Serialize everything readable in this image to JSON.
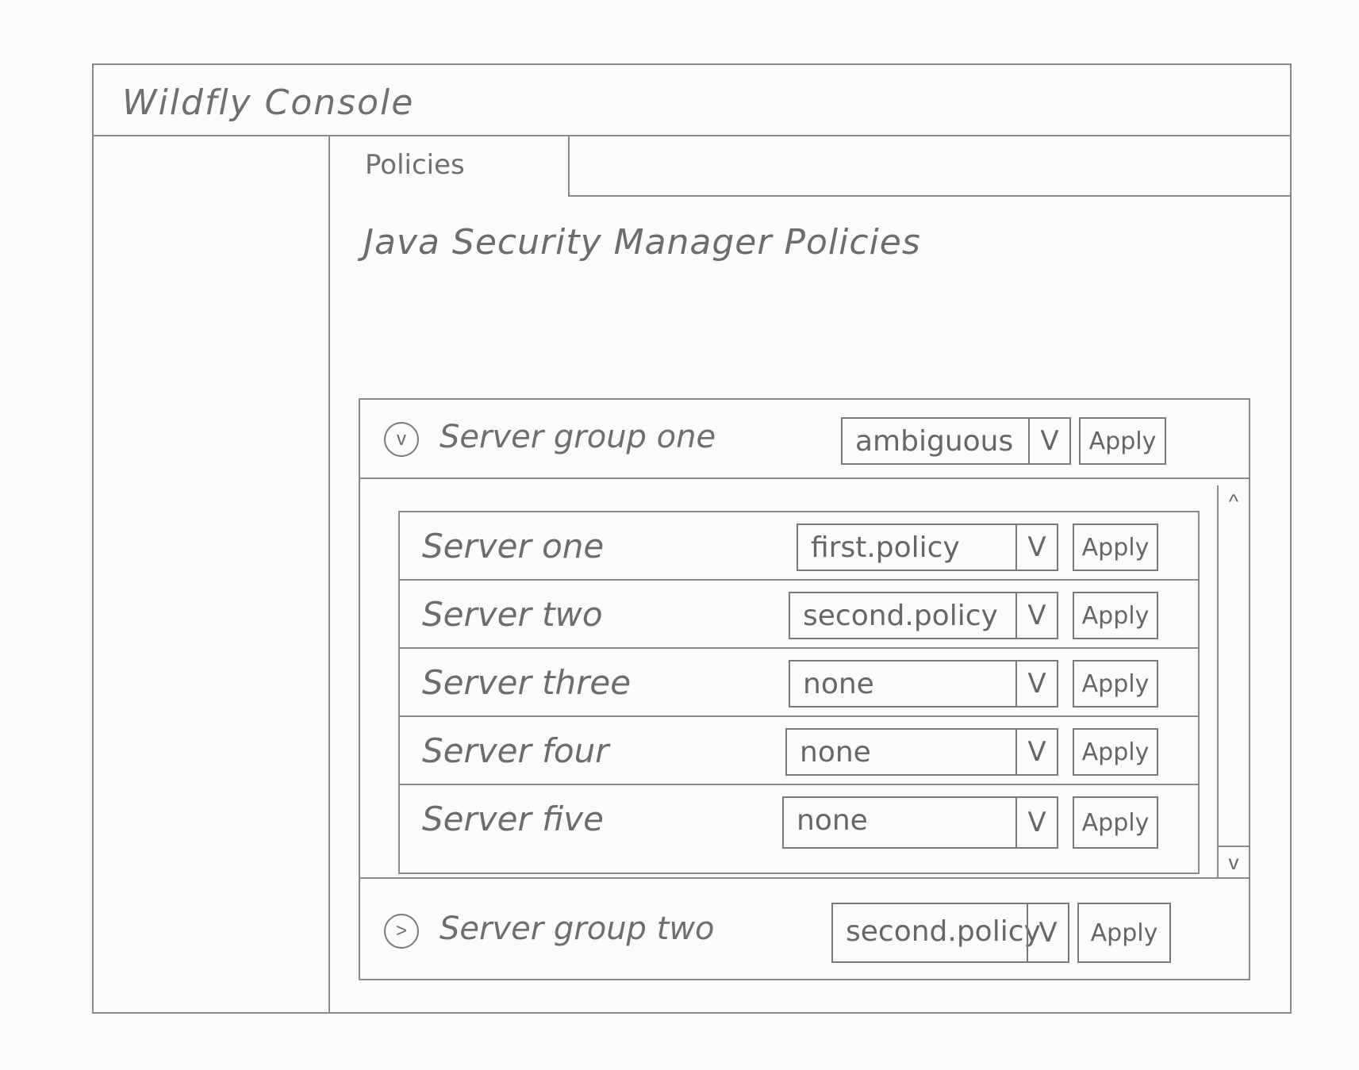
{
  "app": {
    "title": "Wildfly Console"
  },
  "tabs": [
    {
      "label": "Policies"
    }
  ],
  "page": {
    "title": "Java Security Manager Policies"
  },
  "groups": [
    {
      "name": "Server group one",
      "expanded": true,
      "toggle_icon": "v",
      "policy": "ambiguous",
      "apply_label": "Apply",
      "servers": [
        {
          "name": "Server one",
          "policy": "first.policy",
          "apply_label": "Apply"
        },
        {
          "name": "Server two",
          "policy": "second.policy",
          "apply_label": "Apply"
        },
        {
          "name": "Server three",
          "policy": "none",
          "apply_label": "Apply"
        },
        {
          "name": "Server four",
          "policy": "none",
          "apply_label": "Apply"
        },
        {
          "name": "Server five",
          "policy": "none",
          "apply_label": "Apply"
        }
      ]
    },
    {
      "name": "Server group two",
      "expanded": false,
      "toggle_icon": ">",
      "policy": "second.policy",
      "apply_label": "Apply"
    }
  ],
  "icons": {
    "dropdown": "V",
    "scroll_up": "^",
    "scroll_down": "v"
  }
}
